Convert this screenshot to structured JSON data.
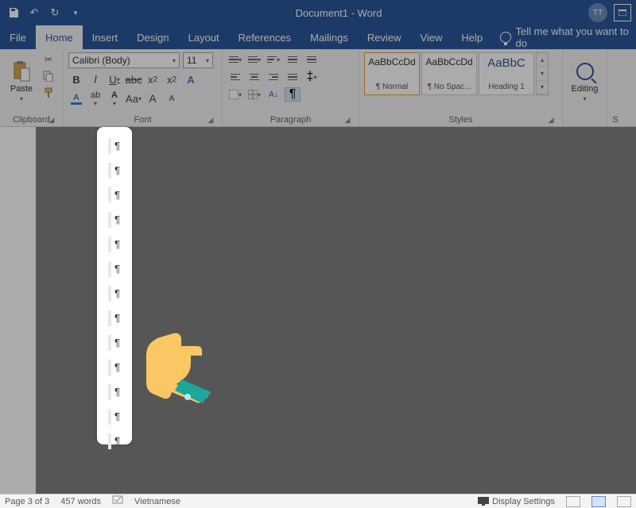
{
  "titlebar": {
    "doc_title": "Document1 - Word",
    "avatar_initials": "TT"
  },
  "tabs": {
    "file": "File",
    "home": "Home",
    "insert": "Insert",
    "design": "Design",
    "layout": "Layout",
    "references": "References",
    "mailings": "Mailings",
    "review": "Review",
    "view": "View",
    "help": "Help",
    "tellme": "Tell me what you want to do"
  },
  "ribbon": {
    "clipboard": {
      "paste": "Paste",
      "label": "Clipboard"
    },
    "font": {
      "name": "Calibri (Body)",
      "size": "11",
      "label": "Font"
    },
    "paragraph": {
      "label": "Paragraph"
    },
    "styles": {
      "label": "Styles",
      "items": [
        {
          "preview": "AaBbCcDd",
          "name": "¶ Normal"
        },
        {
          "preview": "AaBbCcDd",
          "name": "¶ No Spac..."
        },
        {
          "preview": "AaBbC",
          "name": "Heading 1"
        }
      ]
    },
    "editing": {
      "label": "Editing"
    },
    "s_label": "S"
  },
  "statusbar": {
    "page": "Page 3 of 3",
    "words": "457 words",
    "language": "Vietnamese",
    "display": "Display Settings"
  },
  "doc": {
    "paragraph_marks": 13
  }
}
